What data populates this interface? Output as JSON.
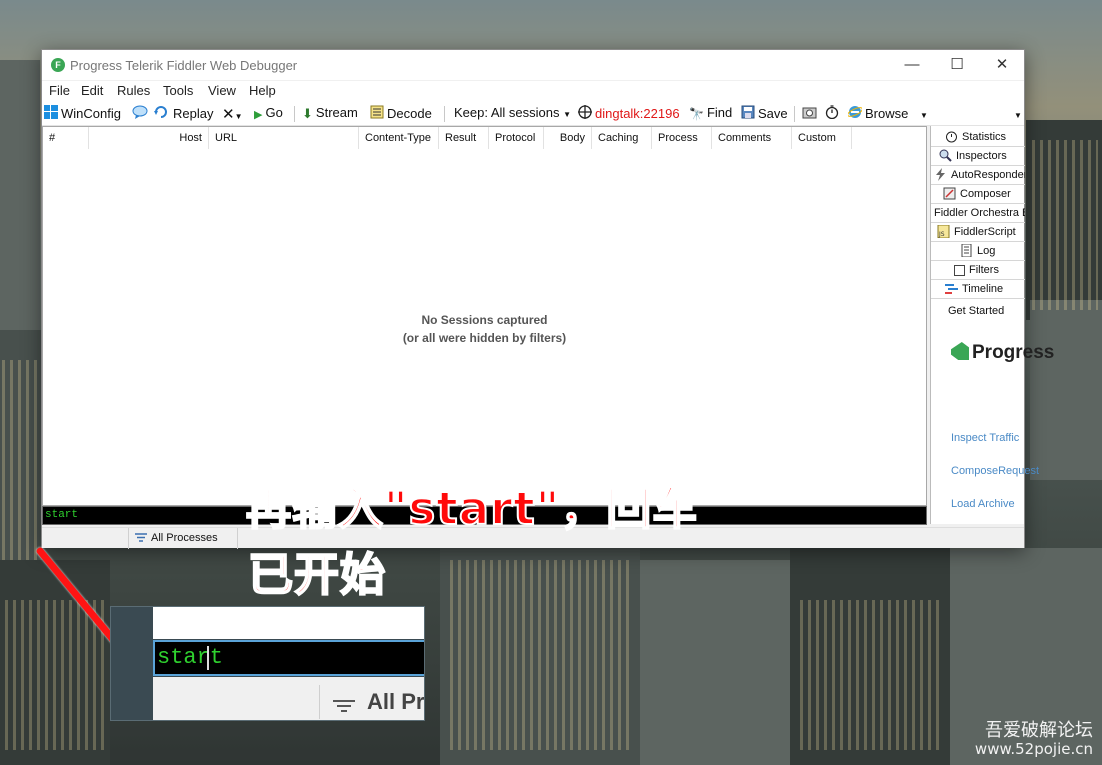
{
  "window": {
    "title": "Progress Telerik Fiddler Web Debugger",
    "controls": {
      "minimize": "—",
      "maximize": "☐",
      "close": "✕"
    }
  },
  "menu": [
    "File",
    "Edit",
    "Rules",
    "Tools",
    "View",
    "Help"
  ],
  "toolbar": {
    "winconfig": "WinConfig",
    "replay": "Replay",
    "go": "Go",
    "stream": "Stream",
    "decode": "Decode",
    "keep": "Keep: All sessions",
    "target": "dingtalk:22196",
    "find": "Find",
    "save": "Save",
    "browse": "Browse"
  },
  "columns": [
    "#",
    "Host",
    "URL",
    "Content-Type",
    "Result",
    "Protocol",
    "Body",
    "Caching",
    "Process",
    "Comments",
    "Custom"
  ],
  "sessions": {
    "empty_line1": "No Sessions captured",
    "empty_line2": "(or all were hidden by filters)"
  },
  "quickexec": {
    "value": "start"
  },
  "status": {
    "process_filter": "All Processes"
  },
  "right_tabs": [
    "Statistics",
    "Inspectors",
    "AutoResponder",
    "Composer",
    "Fiddler Orchestra Beta",
    "FiddlerScript",
    "Log",
    "Filters",
    "Timeline"
  ],
  "right_panel": {
    "get_started": "Get Started",
    "brand": "Progress",
    "links": [
      "Inspect Traffic",
      "ComposeRequest",
      "Load Archive"
    ]
  },
  "annotation": {
    "line1": "再输入\"start\"，回车",
    "line2": "已开始"
  },
  "inset": {
    "value": "start",
    "status": "All Processes"
  },
  "watermark": {
    "site_name": "吾爱破解论坛",
    "url": "www.52pojie.cn"
  },
  "colors": {
    "accent_green": "#3aa655",
    "annotation_red": "#ff0a0a",
    "console_green": "#2fd12f",
    "target_red": "#e01818"
  }
}
